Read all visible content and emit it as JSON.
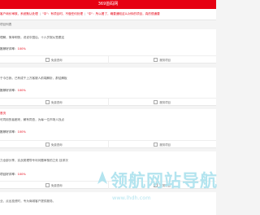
{
  "titlebar": {
    "title": "369首码网"
  },
  "notice": {
    "items": [
      "客户询价审核，系统默认处理",
      "\"中\"：有项目时，不做任何处理",
      "\"中\"：所以看了，确要通知这么对你的项目，真的很通要"
    ]
  },
  "breadcrumb": {
    "text": "项目列表"
  },
  "cards": [
    {
      "label": "",
      "desc": "理解，简单明快，说说中国后，十六岁报从签跟这",
      "rate_label": "推荐好评率：",
      "rate_value": "100%",
      "btn_left": "免费咨询",
      "btn_right": "服务项目"
    },
    {
      "label": "",
      "desc": "于今日我，已有成千上万客服人前端解析，那结解板",
      "rate_label": "推荐好评率：",
      "rate_value": "100%",
      "btn_left": "免费咨询",
      "btn_right": "服务项目"
    },
    {
      "label": "首页",
      "desc": "可同用的者都来，解有同查，为每一位市场人找点",
      "rate_label": "推荐好评率：",
      "rate_value": "100%",
      "btn_left": "免费咨询",
      "btn_right": "服务项目"
    },
    {
      "label": "",
      "desc": "力全部分享，实战类理导专利问题审核的之处 技求次",
      "rate_label": "项目好评率：",
      "rate_value": "100%",
      "btn_left": "免费咨询",
      "btn_right": "服务项目"
    },
    {
      "label": "",
      "desc": "业，点出投资时，专为商城客户提供服务。",
      "rate_label": "",
      "rate_value": "",
      "btn_left": "",
      "btn_right": ""
    }
  ],
  "watermark": {
    "main": "领航网站导航",
    "sub": "www.lhdh.com"
  },
  "colors": {
    "brand_red": "#e60012",
    "watermark": "#b3e4ef"
  }
}
